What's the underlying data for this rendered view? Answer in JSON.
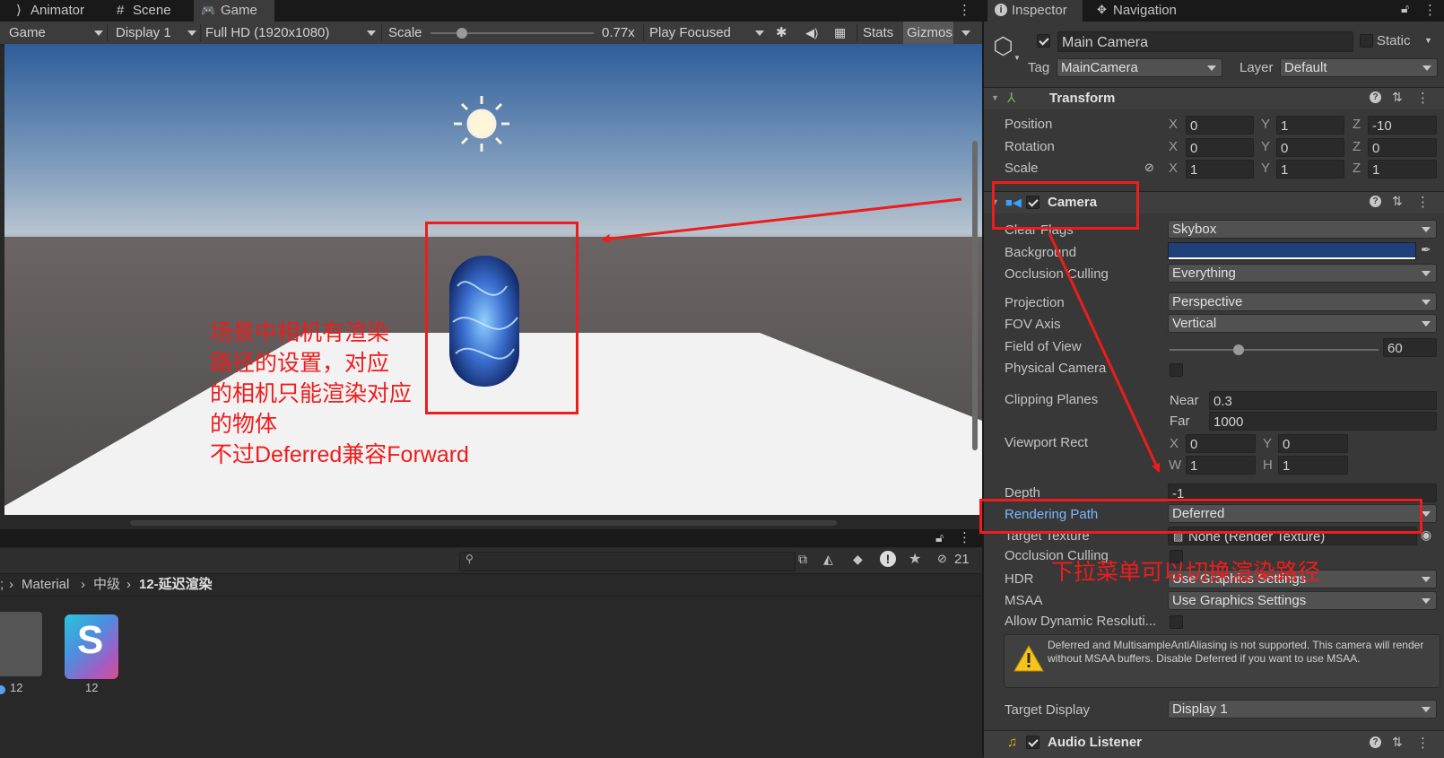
{
  "game_panel": {
    "tabs": [
      {
        "label": "Animator",
        "icon": "animator-icon"
      },
      {
        "label": "Scene",
        "icon": "scene-grid-icon"
      },
      {
        "label": "Game",
        "icon": "gamepad-icon"
      }
    ],
    "toolbar": {
      "view_select": "Game",
      "display": "Display 1",
      "resolution": "Full HD (1920x1080)",
      "scale_label": "Scale",
      "scale_value": "0.77x",
      "scale_level": 0.19,
      "play_mode": "Play Focused",
      "stats": "Stats",
      "gizmos": "Gizmos"
    }
  },
  "project_panel": {
    "breadcrumb": [
      "Material",
      "中级",
      "12-延迟渲染"
    ],
    "assets": [
      {
        "label": "12",
        "kind": "material"
      },
      {
        "label": "12",
        "kind": "shader",
        "glyph": "S"
      }
    ],
    "hidden_count": "21"
  },
  "inspector": {
    "tabs": [
      {
        "label": "Inspector",
        "icon": "info-icon"
      },
      {
        "label": "Navigation",
        "icon": "navigation-icon"
      }
    ],
    "object": {
      "name": "Main Camera",
      "static_label": "Static",
      "tag_label": "Tag",
      "tag": "MainCamera",
      "layer_label": "Layer",
      "layer": "Default"
    },
    "transform": {
      "title": "Transform",
      "rows": [
        {
          "label": "Position",
          "x": "0",
          "y": "1",
          "z": "-10"
        },
        {
          "label": "Rotation",
          "x": "0",
          "y": "0",
          "z": "0"
        },
        {
          "label": "Scale",
          "x": "1",
          "y": "1",
          "z": "1"
        }
      ]
    },
    "camera": {
      "title": "Camera",
      "clear_flags_label": "Clear Flags",
      "clear_flags": "Skybox",
      "background_label": "Background",
      "background_color": "#1f3f78",
      "occlusion_label": "Occlusion Culling",
      "culling_mask": "Everything",
      "projection_label": "Projection",
      "projection": "Perspective",
      "fov_axis_label": "FOV Axis",
      "fov_axis": "Vertical",
      "fov_label": "Field of View",
      "fov": "60",
      "fov_level": 0.33,
      "physical_label": "Physical Camera",
      "clipping_label": "Clipping Planes",
      "near_label": "Near",
      "near": "0.3",
      "far_label": "Far",
      "far": "1000",
      "viewport_label": "Viewport Rect",
      "vp_x": "0",
      "vp_y": "0",
      "vp_w": "1",
      "vp_h": "1",
      "depth_label": "Depth",
      "depth": "-1",
      "rendering_path_label": "Rendering Path",
      "rendering_path": "Deferred",
      "target_texture_label": "Target Texture",
      "target_texture": "None (Render Texture)",
      "occlusion2_label": "Occlusion Culling",
      "hdr_label": "HDR",
      "hdr": "Use Graphics Settings",
      "msaa_label": "MSAA",
      "msaa": "Use Graphics Settings",
      "dynres_label": "Allow Dynamic Resoluti...",
      "warning": "Deferred and MultisampleAntiAliasing is not supported. This camera will render without MSAA buffers. Disable Deferred if you want to use MSAA.",
      "target_display_label": "Target Display",
      "target_display": "Display 1"
    },
    "audio_listener": {
      "title": "Audio Listener"
    }
  },
  "annotations": {
    "scene_note": [
      "场景中相机有渲染",
      "路径的设置，对应",
      "的相机只能渲染对应",
      "的物体",
      "不过Deferred兼容Forward"
    ],
    "dropdown_note": "下拉菜单可以切换渲染路径",
    "color": "#ee1c1c"
  }
}
